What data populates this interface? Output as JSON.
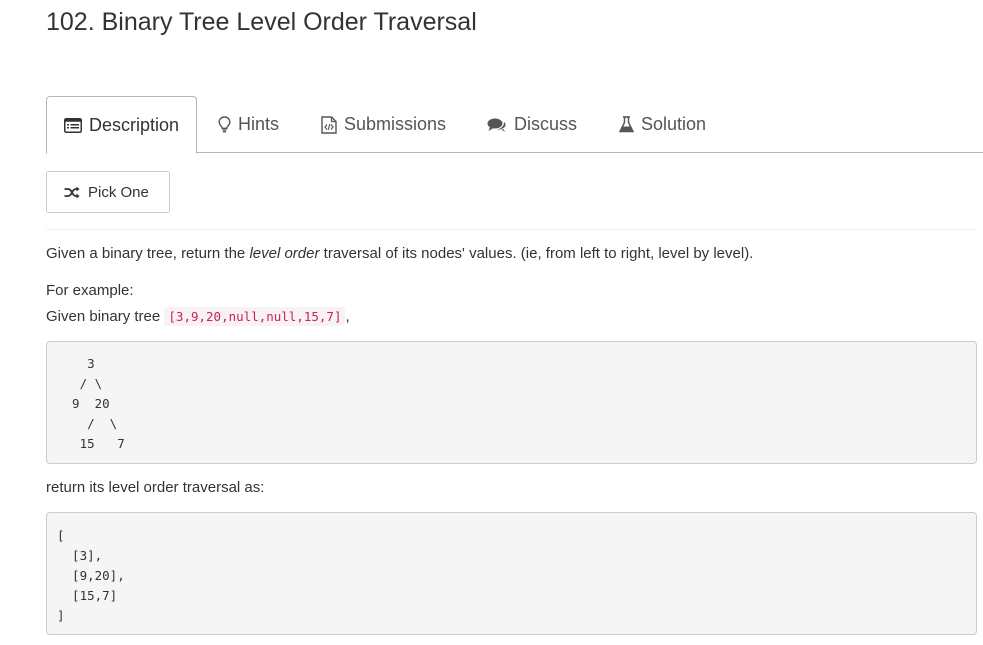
{
  "problem": {
    "title": "102. Binary Tree Level Order Traversal"
  },
  "tabs": [
    {
      "label": "Description",
      "icon": "list-alt-icon",
      "active": true
    },
    {
      "label": "Hints",
      "icon": "lightbulb-icon",
      "active": false
    },
    {
      "label": "Submissions",
      "icon": "file-code-icon",
      "active": false
    },
    {
      "label": "Discuss",
      "icon": "comments-icon",
      "active": false
    },
    {
      "label": "Solution",
      "icon": "flask-icon",
      "active": false
    }
  ],
  "pick_one": {
    "label": "Pick One",
    "icon": "random-icon"
  },
  "description": {
    "intro_before": "Given a binary tree, return the ",
    "intro_emphasis": "level order",
    "intro_after": " traversal of its nodes' values. (ie, from left to right, level by level).",
    "example_label": "For example:",
    "given_prefix": "Given binary tree ",
    "given_code": "[3,9,20,null,null,15,7]",
    "given_suffix": ",",
    "tree_diagram": "    3\n   / \\\n  9  20\n    /  \\\n   15   7",
    "return_label": "return its level order traversal as:",
    "result_code": "[\n  [3],\n  [9,20],\n  [15,7]\n]"
  },
  "colors": {
    "text": "#333333",
    "inline_code_text": "#c7254e",
    "inline_code_bg": "#f9f2f4",
    "code_block_bg": "#f5f5f5",
    "border": "#cccccc"
  }
}
